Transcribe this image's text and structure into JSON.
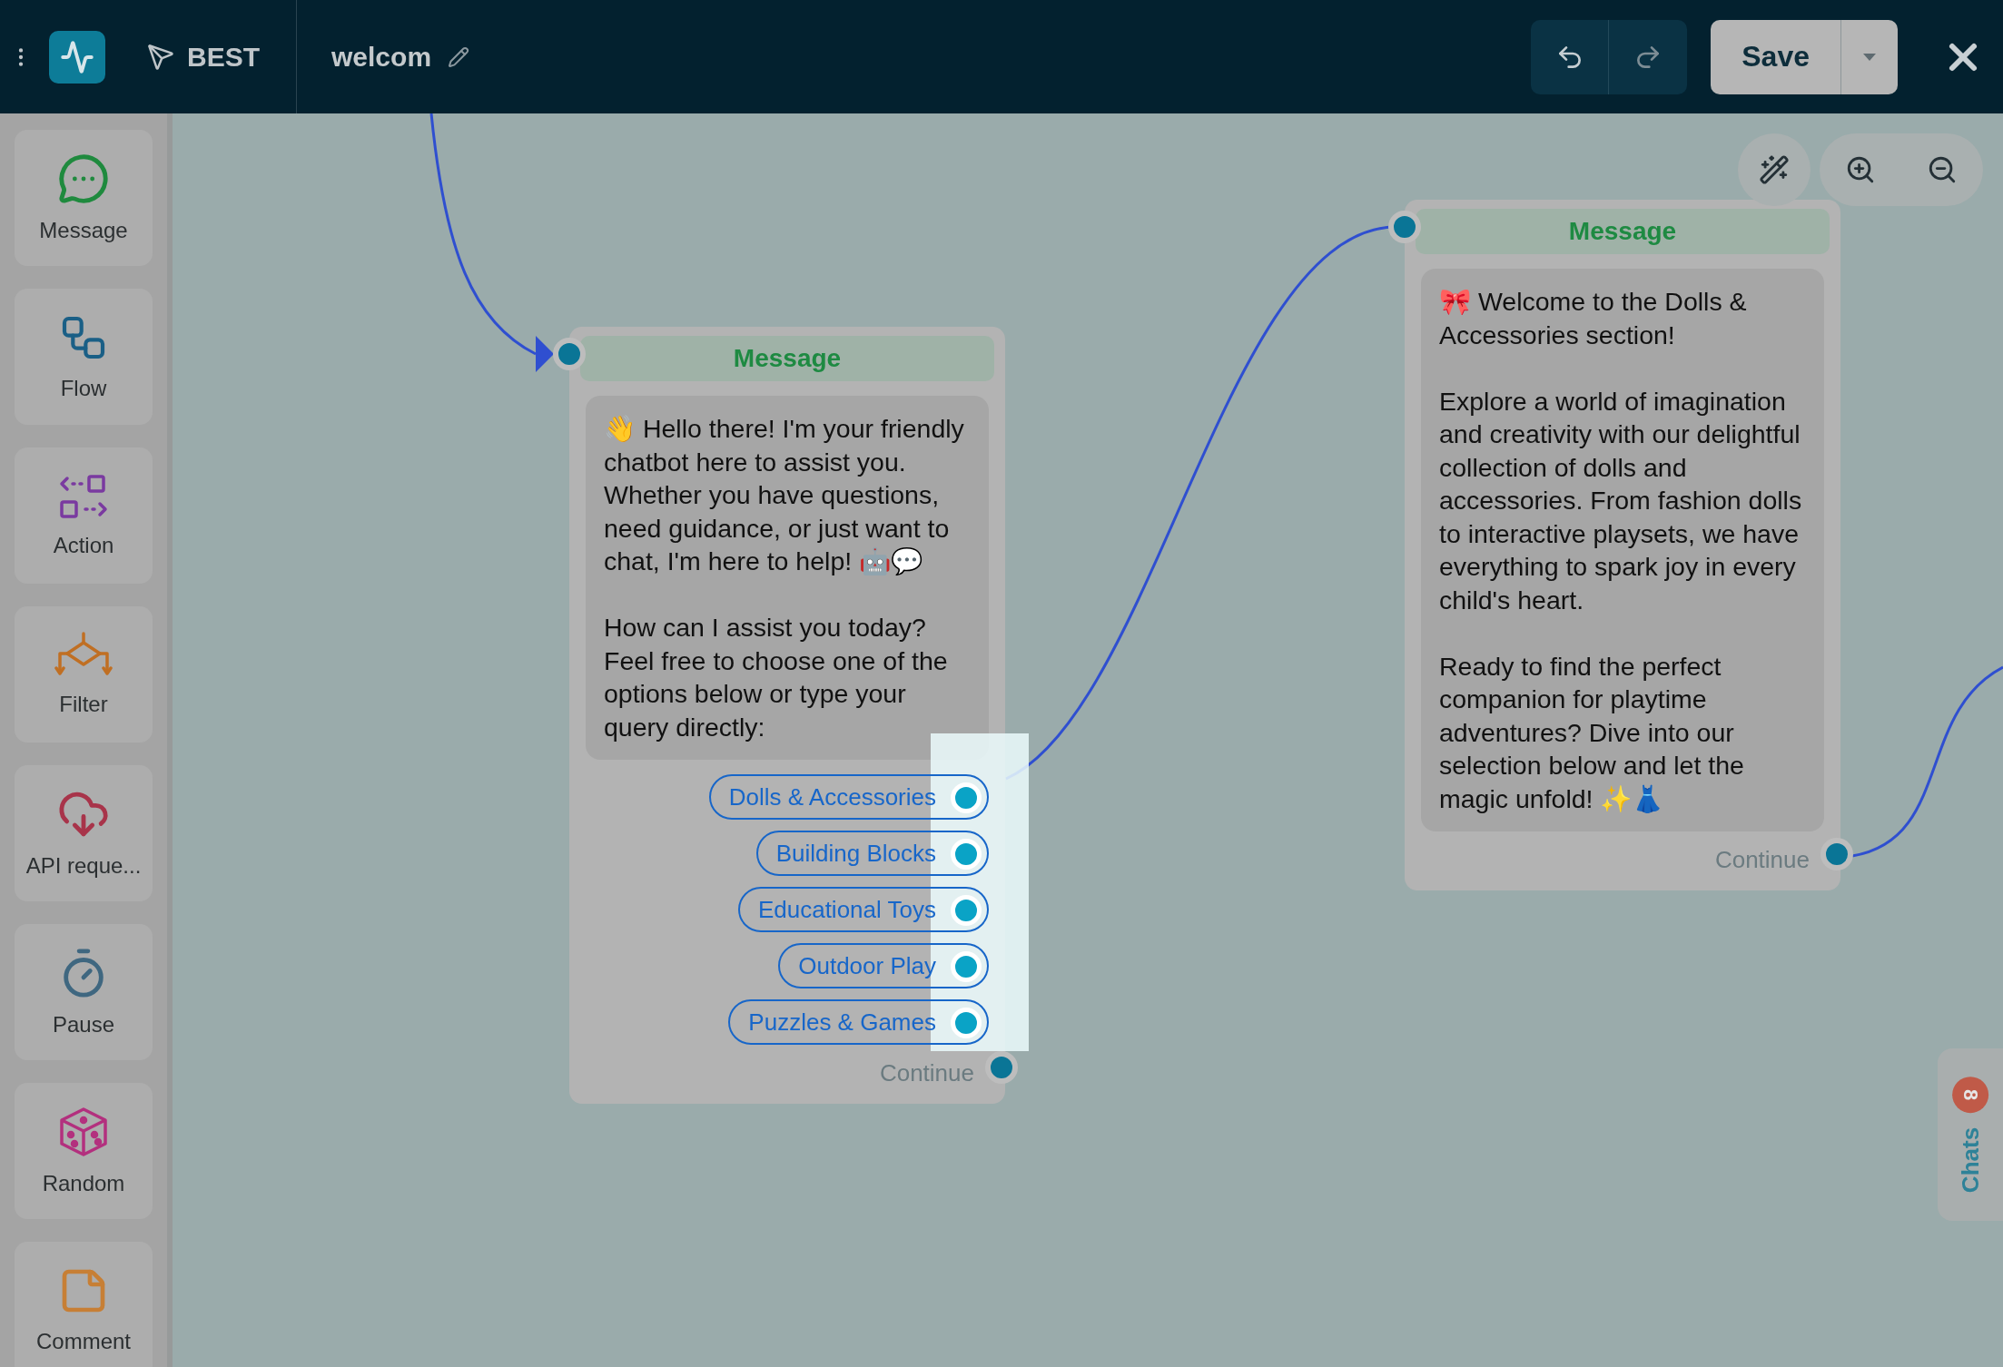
{
  "top_bar": {
    "brand": "BEST",
    "flow_name": "welcom",
    "save": "Save"
  },
  "sidebar": {
    "items": [
      {
        "kind": "message",
        "label": "Message"
      },
      {
        "kind": "flow",
        "label": "Flow"
      },
      {
        "kind": "action",
        "label": "Action"
      },
      {
        "kind": "filter",
        "label": "Filter"
      },
      {
        "kind": "api",
        "label": "API reque..."
      },
      {
        "kind": "pause",
        "label": "Pause"
      },
      {
        "kind": "random",
        "label": "Random"
      },
      {
        "kind": "comment",
        "label": "Comment"
      }
    ]
  },
  "nodes": [
    {
      "title": "Message",
      "text": "👋 Hello there! I'm your friendly chatbot here to assist you. Whether you have questions, need guidance, or just want to chat, I'm here to help! 🤖💬\n\nHow can I assist you today? Feel free to choose one of the options below or type your query directly:",
      "options": [
        "Dolls & Accessories",
        "Building Blocks",
        "Educational Toys",
        "Outdoor Play",
        "Puzzles & Games"
      ],
      "continue": "Continue"
    },
    {
      "title": "Message",
      "text": "🎀 Welcome to the Dolls & Accessories section!\n\nExplore a world of imagination and creativity with our delightful collection of dolls and accessories. From fashion dolls to interactive playsets, we have everything to spark joy in every child's heart.\n\nReady to find the perfect companion for playtime adventures? Dive into our selection below and let the magic unfold! ✨👗",
      "continue": "Continue"
    }
  ],
  "chats": {
    "label": "Chats",
    "count": "8"
  }
}
